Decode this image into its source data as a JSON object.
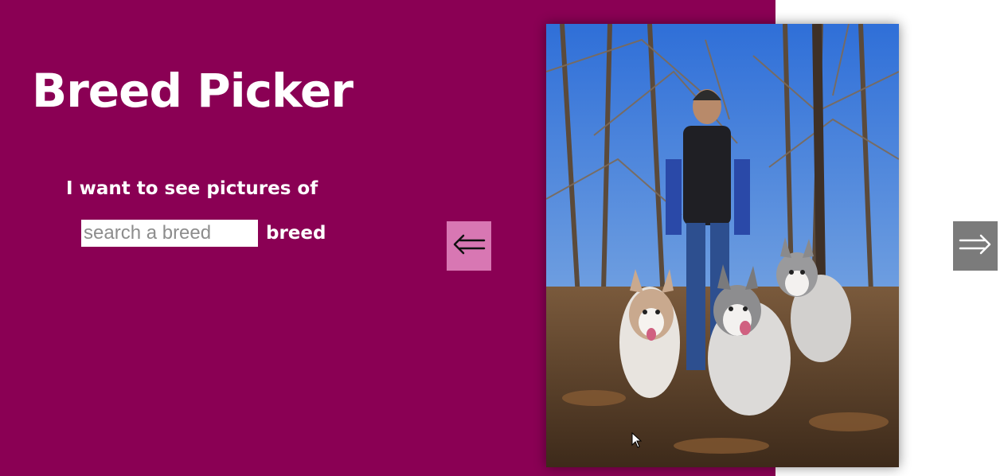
{
  "app": {
    "title": "Breed Picker"
  },
  "search": {
    "prompt": "I want to see pictures of",
    "placeholder": "search a breed",
    "value": "",
    "suffix": "breed"
  },
  "nav": {
    "prev_icon": "left-arrow-icon",
    "prev_glyph": "⟸",
    "next_icon": "right-arrow-icon",
    "next_glyph": "⟹"
  },
  "colors": {
    "brand": "#8a0054",
    "prev_button": "#d877b3",
    "next_button": "#7b7b7b"
  }
}
